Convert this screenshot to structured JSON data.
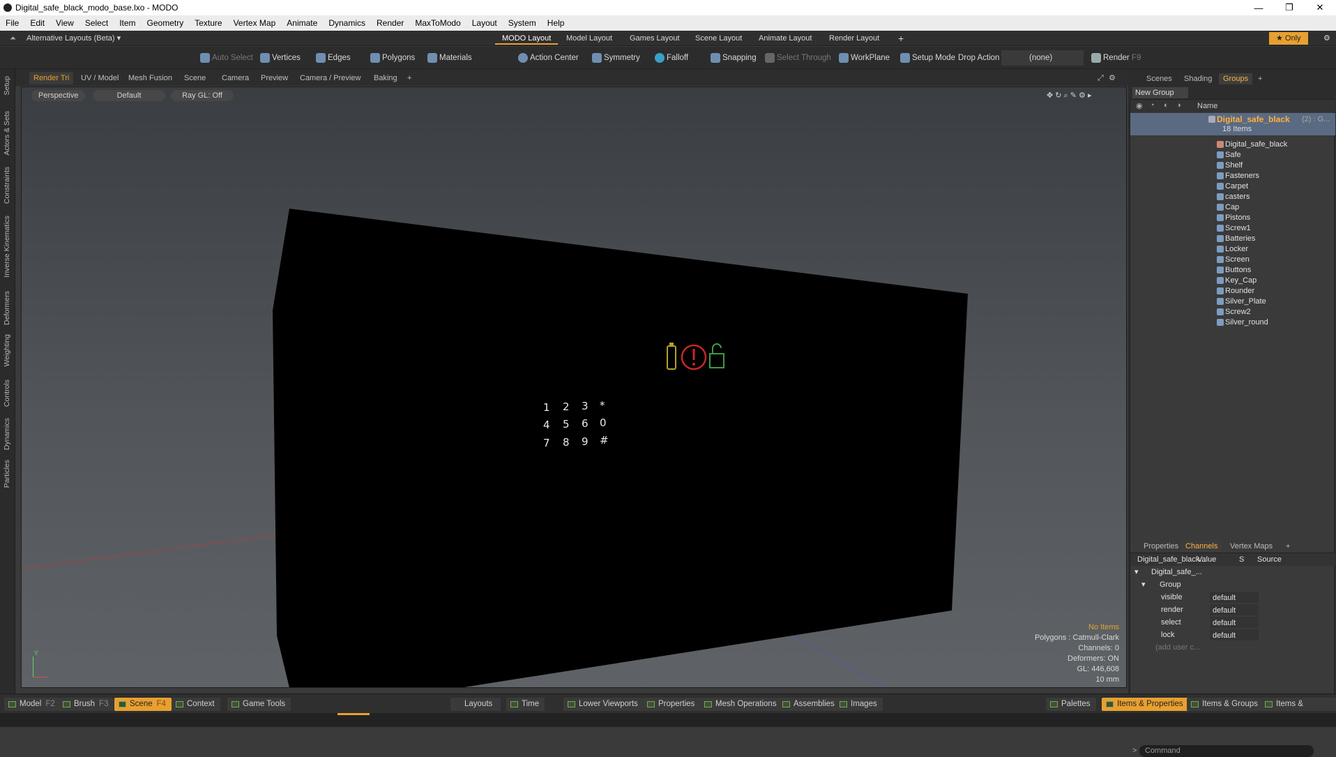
{
  "window": {
    "title": "Digital_safe_black_modo_base.lxo - MODO",
    "min": "—",
    "max": "❐",
    "close": "✕"
  },
  "menu": [
    "File",
    "Edit",
    "View",
    "Select",
    "Item",
    "Geometry",
    "Texture",
    "Vertex Map",
    "Animate",
    "Dynamics",
    "Render",
    "MaxToModo",
    "Layout",
    "System",
    "Help"
  ],
  "layoutbar": {
    "alt": "Alternative Layouts (Beta) ▾",
    "tabs": [
      "MODO Layout",
      "Model Layout",
      "Games Layout",
      "Scene Layout",
      "Animate Layout",
      "Render Layout"
    ],
    "plus": "+",
    "only": "★  Only"
  },
  "toolbar": {
    "items": [
      "Auto Select",
      "Vertices",
      "Edges",
      "Polygons",
      "Materials",
      "Action Center",
      "Symmetry",
      "Falloff",
      "Snapping",
      "Select Through",
      "WorkPlane",
      "Setup Mode"
    ],
    "drop_action": "Drop Action",
    "drop_value": "(none)",
    "render": "Render",
    "render_key": "F9"
  },
  "lefttabs": [
    "Setup",
    "Actors & Sets",
    "Constraints",
    "Inverse Kinematics",
    "Deformers",
    "Weighting",
    "Controls",
    "Dynamics",
    "Particles"
  ],
  "viewport_tabs": [
    "Render Tri",
    "UV / Model",
    "Mesh Fusion",
    "Scene",
    "Camera",
    "Preview",
    "Camera / Preview",
    "Baking",
    "+"
  ],
  "viewport": {
    "chips": [
      "Perspective",
      "Default",
      "Ray GL: Off"
    ],
    "keypad": [
      "1",
      "2",
      "3",
      "*",
      "4",
      "5",
      "6",
      "0",
      "7",
      "8",
      "9",
      "#"
    ],
    "hud": [
      "No Items",
      "Polygons : Catmull-Clark",
      "Channels: 0",
      "Deformers: ON",
      "GL: 446,608",
      "10 mm"
    ],
    "axis_y": "Y"
  },
  "groups_panel": {
    "tabs": [
      "Scenes",
      "Shading",
      "Groups",
      "+"
    ],
    "new_group": "New Group",
    "col_name": "Name",
    "root": "Digital_safe_black",
    "root_suffix": "(2) : G...",
    "count": "18 Items",
    "items": [
      "Digital_safe_black",
      "Safe",
      "Shelf",
      "Fasteners",
      "Carpet",
      "casters",
      "Cap",
      "Pistons",
      "Screw1",
      "Batteries",
      "Locker",
      "Screen",
      "Buttons",
      "Key_Cap",
      "Rounder",
      "Silver_Plate",
      "Screw2",
      "Silver_round"
    ]
  },
  "channels_panel": {
    "tabs": [
      "Properties",
      "Channels",
      "Vertex Maps",
      "+"
    ],
    "header": [
      "Digital_safe_black...",
      "Value",
      "S",
      "Source"
    ],
    "tree": [
      "Digital_safe_...",
      "Group"
    ],
    "rows": [
      {
        "name": "visible",
        "value": "default"
      },
      {
        "name": "render",
        "value": "default"
      },
      {
        "name": "select",
        "value": "default"
      },
      {
        "name": "lock",
        "value": "default"
      }
    ],
    "add_user": "(add user c...",
    "command": "Command"
  },
  "bottombar": {
    "left": [
      {
        "label": "Model",
        "key": "F2"
      },
      {
        "label": "Brush",
        "key": "F3"
      },
      {
        "label": "Scene",
        "key": "F4"
      },
      {
        "label": "Context",
        "key": ""
      },
      {
        "label": "Game Tools",
        "key": ""
      }
    ],
    "mid": [
      "Layouts",
      "Time",
      "Lower Viewports",
      "Properties",
      "Mesh Operations",
      "Assemblies",
      "Images"
    ],
    "right": [
      "Palettes",
      "Items & Properties",
      "Items & Groups",
      "Items & Shading"
    ]
  },
  "colors": {
    "accent": "#e8a030",
    "battery": "#b3a12c",
    "alert": "#c42828",
    "lock": "#3f9a3f"
  }
}
